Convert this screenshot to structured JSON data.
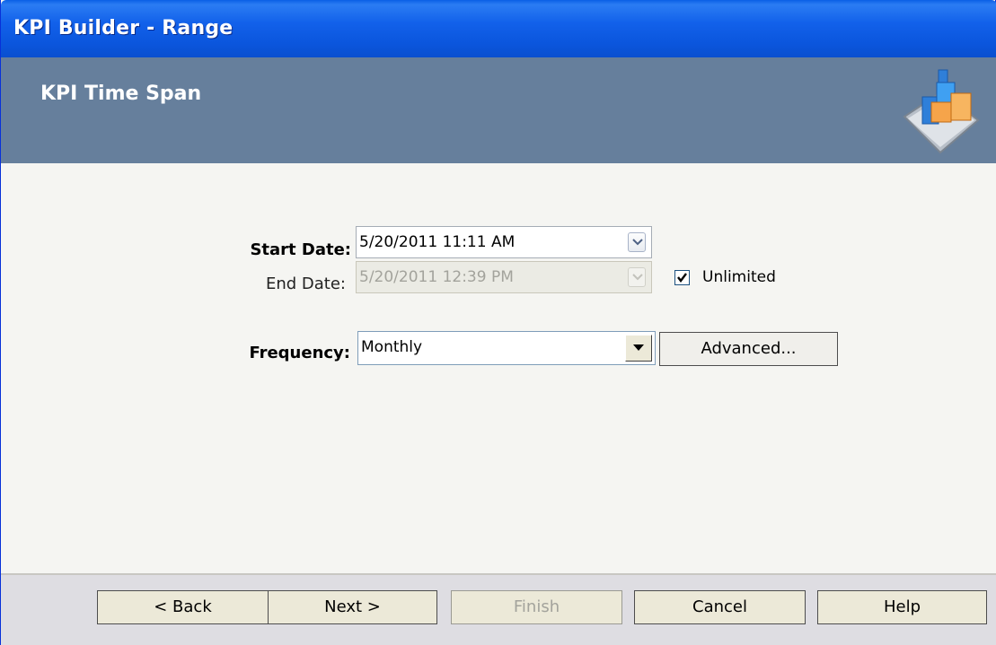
{
  "window": {
    "title": "KPI Builder - Range"
  },
  "header": {
    "heading": "KPI Time Span",
    "logo_icon": "kpi-chart-logo-icon"
  },
  "form": {
    "start_date": {
      "label": "Start Date:",
      "value": "5/20/2011 11:11 AM"
    },
    "end_date": {
      "label": "End Date:",
      "value": "5/20/2011 12:39 PM",
      "disabled": true
    },
    "unlimited": {
      "label": "Unlimited",
      "checked": true
    },
    "frequency": {
      "label": "Frequency:",
      "value": "Monthly"
    },
    "advanced_label": "Advanced..."
  },
  "footer": {
    "back_label": "< Back",
    "next_label": "Next >",
    "finish_label": "Finish",
    "cancel_label": "Cancel",
    "help_label": "Help"
  },
  "colors": {
    "titlebar": "#0b56dd",
    "header": "#667f9c",
    "body": "#f5f5f2",
    "footer": "#dedde2"
  }
}
